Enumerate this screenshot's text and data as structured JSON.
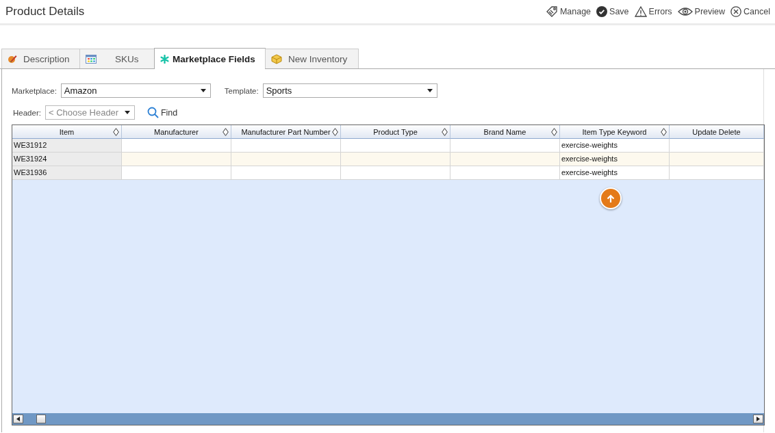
{
  "page": {
    "title": "Product Details"
  },
  "actions": [
    {
      "label": "Manage"
    },
    {
      "label": "Save"
    },
    {
      "label": "Errors"
    },
    {
      "label": "Preview"
    },
    {
      "label": "Cancel"
    }
  ],
  "tabs": [
    {
      "label": "Description",
      "selected": false
    },
    {
      "label": "SKUs",
      "selected": false
    },
    {
      "label": "Marketplace Fields",
      "selected": true
    },
    {
      "label": "New Inventory",
      "selected": false
    }
  ],
  "filters": {
    "marketplace": {
      "label": "Marketplace:",
      "value": "Amazon"
    },
    "template": {
      "label": "Template:",
      "value": "Sports"
    },
    "header": {
      "label": "Header:",
      "placeholder": "< Choose Header"
    },
    "find": "Find"
  },
  "table": {
    "columns": [
      {
        "label": "Item",
        "sortable": true
      },
      {
        "label": "Manufacturer",
        "sortable": true
      },
      {
        "label": "Manufacturer Part Number",
        "sortable": true
      },
      {
        "label": "Product Type",
        "sortable": true
      },
      {
        "label": "Brand Name",
        "sortable": true
      },
      {
        "label": "Item Type Keyword",
        "sortable": true
      },
      {
        "label": "Update Delete",
        "sortable": false
      }
    ],
    "rows": [
      {
        "cells": [
          "WE31912",
          "",
          "",
          "",
          "",
          "exercise-weights",
          ""
        ]
      },
      {
        "cells": [
          "WE31924",
          "",
          "",
          "",
          "",
          "exercise-weights",
          ""
        ]
      },
      {
        "cells": [
          "WE31936",
          "",
          "",
          "",
          "",
          "exercise-weights",
          ""
        ]
      }
    ]
  }
}
